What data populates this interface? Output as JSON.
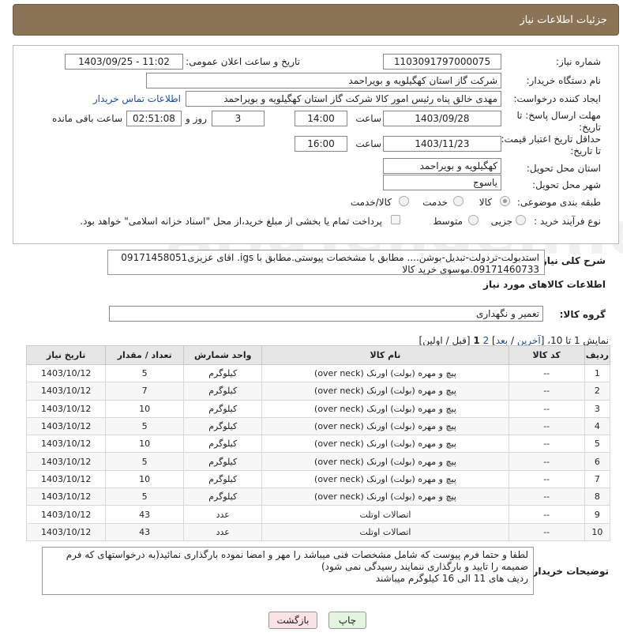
{
  "header": {
    "title": "جزئیات اطلاعات نیاز"
  },
  "fields": {
    "need_number_label": "شماره نیاز:",
    "need_number": "1103091797000075",
    "announce_label": "تاریخ و ساعت اعلان عمومی:",
    "announce_value": "1403/09/25 - 11:02",
    "buyer_org_label": "نام دستگاه خریدار:",
    "buyer_org": "شرکت گاز استان کهگیلویه و بویراحمد",
    "creator_label": "ایجاد کننده درخواست:",
    "creator": "مهدی خالق پناه رئیس امور کالا شرکت گاز استان کهگیلویه و بویراحمد",
    "contact_link": "اطلاعات تماس خریدار",
    "deadline_label": "مهلت ارسال پاسخ: تا تاریخ:",
    "deadline_date": "1403/09/28",
    "time_label": "ساعت",
    "deadline_time": "14:00",
    "days_value": "3",
    "days_label": "روز و",
    "remaining_time": "02:51:08",
    "remaining_label": "ساعت باقی مانده",
    "price_validity_label": "حداقل تاریخ اعتبار قیمت: تا تاریخ:",
    "price_validity_date": "1403/11/23",
    "price_validity_time": "16:00",
    "province_label": "استان محل تحویل:",
    "province": "کهگیلویه و بویراحمد",
    "city_label": "شهر محل تحویل:",
    "city": "یاسوج",
    "category_label": "طبقه بندی موضوعی:",
    "category_options": [
      "کالا",
      "خدمت",
      "کالا/خدمت"
    ],
    "process_label": "نوع فرآیند خرید :",
    "process_options": [
      "جزیی",
      "متوسط"
    ],
    "payment_note": "پرداخت تمام یا بخشی از مبلغ خرید،از محل \"اسناد خزانه اسلامی\" خواهد بود."
  },
  "summary": {
    "label": "شرح کلی نیاز:",
    "line1": "استدبولت-تردولت-تبدیل-بوشن.... مطابق با مشخصات پیوستی.مطابق با igs. اقای عزیزی09171458051",
    "line2": "09171460733.موسوی خرید کالا"
  },
  "goods": {
    "section_title": "اطلاعات کالاهای مورد نیاز",
    "group_label": "گروه کالا:",
    "group_value": "تعمیر و نگهداری",
    "pagination": {
      "prefix": "نمایش 1 تا 10، [",
      "last": "آخرین",
      "sep1": " / ",
      "next": "بعد",
      "sep2": "] ",
      "page2": "2",
      "page1": "1",
      "suffix": " [قبل / اولین]"
    }
  },
  "table": {
    "headers": [
      "ردیف",
      "کد کالا",
      "نام کالا",
      "واحد شمارش",
      "تعداد / مقدار",
      "تاریخ نیاز"
    ],
    "rows": [
      [
        "1",
        "--",
        "پیچ و مهره (بولت) اورنک (over neck)",
        "کیلوگرم",
        "5",
        "1403/10/12"
      ],
      [
        "2",
        "--",
        "پیچ و مهره (بولت) اورنک (over neck)",
        "کیلوگرم",
        "7",
        "1403/10/12"
      ],
      [
        "3",
        "--",
        "پیچ و مهره (بولت) اورنک (over neck)",
        "کیلوگرم",
        "10",
        "1403/10/12"
      ],
      [
        "4",
        "--",
        "پیچ و مهره (بولت) اورنک (over neck)",
        "کیلوگرم",
        "5",
        "1403/10/12"
      ],
      [
        "5",
        "--",
        "پیچ و مهره (بولت) اورنک (over neck)",
        "کیلوگرم",
        "10",
        "1403/10/12"
      ],
      [
        "6",
        "--",
        "پیچ و مهره (بولت) اورنک (over neck)",
        "کیلوگرم",
        "5",
        "1403/10/12"
      ],
      [
        "7",
        "--",
        "پیچ و مهره (بولت) اورنک (over neck)",
        "کیلوگرم",
        "10",
        "1403/10/12"
      ],
      [
        "8",
        "--",
        "پیچ و مهره (بولت) اورنک (over neck)",
        "کیلوگرم",
        "5",
        "1403/10/12"
      ],
      [
        "9",
        "--",
        "اتصالات اوتلت",
        "عدد",
        "43",
        "1403/10/12"
      ],
      [
        "10",
        "--",
        "اتصالات اوتلت",
        "عدد",
        "43",
        "1403/10/12"
      ]
    ]
  },
  "buyer_notes": {
    "label": "توضیحات خریدار:",
    "line1": "لطفا و حتما فرم پیوست که شامل مشخصات فنی میباشد را مهر و امضا نموده بارگذاری نمائید(به درخواستهای که فرم",
    "line2": "ضمیمه را تایید و بارگذاری ننمایند رسیدگی نمی شود)",
    "line3": "ردیف های 11 الی 16  کیلوگرم میباشند"
  },
  "buttons": {
    "print": "چاپ",
    "back": "بازگشت"
  },
  "watermark": "AriaTender.neT",
  "colors": {
    "header_bg": "#8b7355",
    "link": "#1a4ea0",
    "back_button_bg": "#fbe3e3",
    "print_button_bg": "#e3f5df"
  }
}
